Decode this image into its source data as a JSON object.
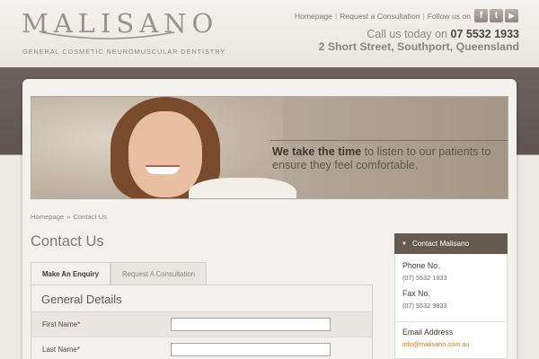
{
  "brand": {
    "logo": "MALISANO",
    "tagline": "GENERAL COSMETIC NEUROMUSCULAR DENTISTRY"
  },
  "topnav": {
    "items": [
      {
        "label": "Homepage"
      },
      {
        "label": "Request a Consultation"
      }
    ],
    "follow_label": "Follow us on",
    "social": [
      {
        "icon": "facebook-icon",
        "glyph": "f"
      },
      {
        "icon": "twitter-icon",
        "glyph": "t"
      },
      {
        "icon": "youtube-icon",
        "glyph": "▶"
      }
    ]
  },
  "contact_header": {
    "call_prefix": "Call us today on",
    "phone": "07 5532 1933",
    "address": "2 Short Street, Southport, Queensland"
  },
  "banner": {
    "emphasis": "We take the time",
    "text": " to listen to our patients to ensure they feel comfortable."
  },
  "breadcrumb": {
    "items": [
      "Homepage",
      "Contact Us"
    ],
    "separator": "»"
  },
  "page": {
    "title": "Contact Us"
  },
  "tabs": [
    {
      "label": "Make An Enquiry",
      "active": true
    },
    {
      "label": "Request A Consultation",
      "active": false
    }
  ],
  "form": {
    "heading": "General Details",
    "fields": [
      {
        "label": "First Name",
        "required_mark": "*",
        "value": ""
      },
      {
        "label": "Last Name",
        "required_mark": "*",
        "value": ""
      }
    ]
  },
  "sidebar": {
    "heading": "Contact Malisano",
    "phone_label": "Phone No.",
    "phone_value": "(07) 5532 1933",
    "fax_label": "Fax No.",
    "fax_value": "(07) 5532 9833",
    "email_label": "Email Address",
    "email_value": "info@malisano.com.au"
  },
  "colors": {
    "accent_dark": "#66594f",
    "link_orange": "#c8741e",
    "required_red": "#b3232d",
    "band_brown": "#5f5450"
  }
}
